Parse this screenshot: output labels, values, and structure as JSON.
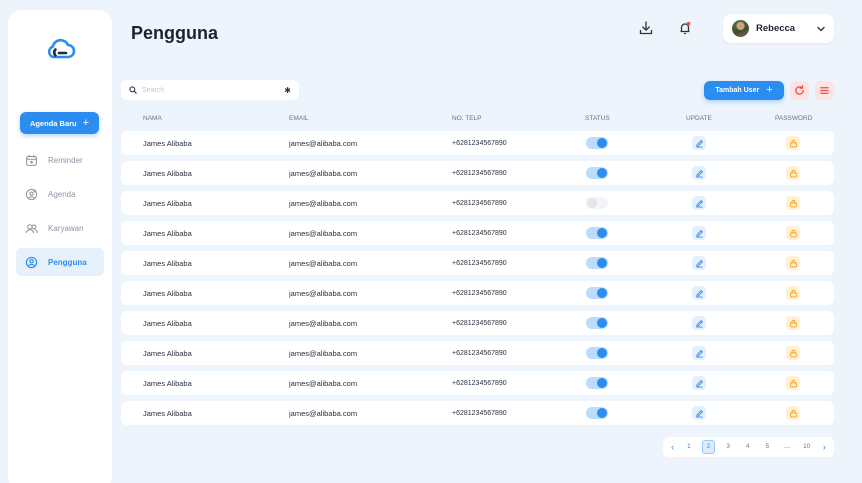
{
  "sidebar": {
    "new_button_label": "Agenda Baru",
    "new_button_plus": "+",
    "items": [
      {
        "label": "Reminder",
        "icon": "calendar-icon"
      },
      {
        "label": "Agenda",
        "icon": "user-add-icon"
      },
      {
        "label": "Karyawan",
        "icon": "users-icon"
      },
      {
        "label": "Pengguna",
        "icon": "user-circle-icon",
        "active": true
      }
    ]
  },
  "header": {
    "title": "Pengguna",
    "user_name": "Rebecca",
    "chevron": "⌄"
  },
  "toolbar": {
    "search_placeholder": "Search",
    "search_clear": "✱",
    "add_label": "Tambah User",
    "add_plus": "+"
  },
  "table": {
    "columns": [
      "NAMA",
      "EMAIL",
      "NO. TELP",
      "STATUS",
      "UPDATE",
      "PASSWORD"
    ],
    "rows": [
      {
        "name": "James Alibaba",
        "email": "james@alibaba.com",
        "phone": "+6281234567890",
        "active": true
      },
      {
        "name": "James Alibaba",
        "email": "james@alibaba.com",
        "phone": "+6281234567890",
        "active": true
      },
      {
        "name": "James Alibaba",
        "email": "james@alibaba.com",
        "phone": "+6281234567890",
        "active": false
      },
      {
        "name": "James Alibaba",
        "email": "james@alibaba.com",
        "phone": "+6281234567890",
        "active": true
      },
      {
        "name": "James Alibaba",
        "email": "james@alibaba.com",
        "phone": "+6281234567890",
        "active": true
      },
      {
        "name": "James Alibaba",
        "email": "james@alibaba.com",
        "phone": "+6281234567890",
        "active": true
      },
      {
        "name": "James Alibaba",
        "email": "james@alibaba.com",
        "phone": "+6281234567890",
        "active": true
      },
      {
        "name": "James Alibaba",
        "email": "james@alibaba.com",
        "phone": "+6281234567890",
        "active": true
      },
      {
        "name": "James Alibaba",
        "email": "james@alibaba.com",
        "phone": "+6281234567890",
        "active": true
      },
      {
        "name": "James Alibaba",
        "email": "james@alibaba.com",
        "phone": "+6281234567890",
        "active": true
      }
    ]
  },
  "pagination": {
    "prev": "‹",
    "next": "›",
    "pages": [
      "1",
      "2",
      "3",
      "4",
      "5",
      "....",
      "10"
    ],
    "current": "2"
  },
  "colors": {
    "accent": "#2c8df0",
    "background": "#eef4fb",
    "danger_bg": "#fde3e3",
    "danger": "#e8504f",
    "warning_bg": "#fff1d6",
    "warning": "#f0a020"
  }
}
